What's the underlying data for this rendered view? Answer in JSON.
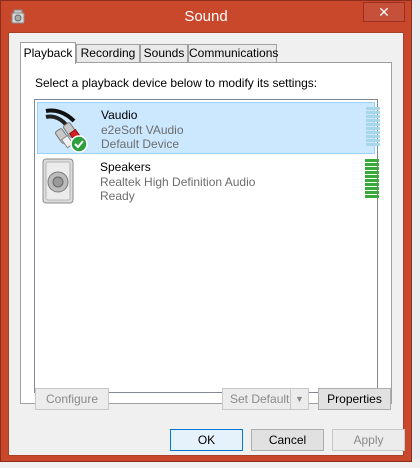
{
  "window": {
    "title": "Sound",
    "close_glyph": "✕"
  },
  "tabs": [
    {
      "label": "Playback",
      "active": true
    },
    {
      "label": "Recording",
      "active": false
    },
    {
      "label": "Sounds",
      "active": false
    },
    {
      "label": "Communications",
      "active": false
    }
  ],
  "instruction": "Select a playback device below to modify its settings:",
  "devices": [
    {
      "name": "Vaudio",
      "description": "e2eSoft VAudio",
      "status": "Default Device",
      "icon": "rca-cable-icon",
      "selected": true,
      "default_badge": "check-badge-icon"
    },
    {
      "name": "Speakers",
      "description": "Realtek High Definition Audio",
      "status": "Ready",
      "icon": "speaker-icon",
      "selected": false
    }
  ],
  "panel_buttons": {
    "configure": "Configure",
    "set_default": "Set Default",
    "properties": "Properties"
  },
  "dialog_buttons": {
    "ok": "OK",
    "cancel": "Cancel",
    "apply": "Apply"
  },
  "colors": {
    "window_frame": "#c9482c",
    "selection_bg": "#cce8ff",
    "meter_green": "#3aa83a",
    "meter_light": "#a6d6e8"
  }
}
